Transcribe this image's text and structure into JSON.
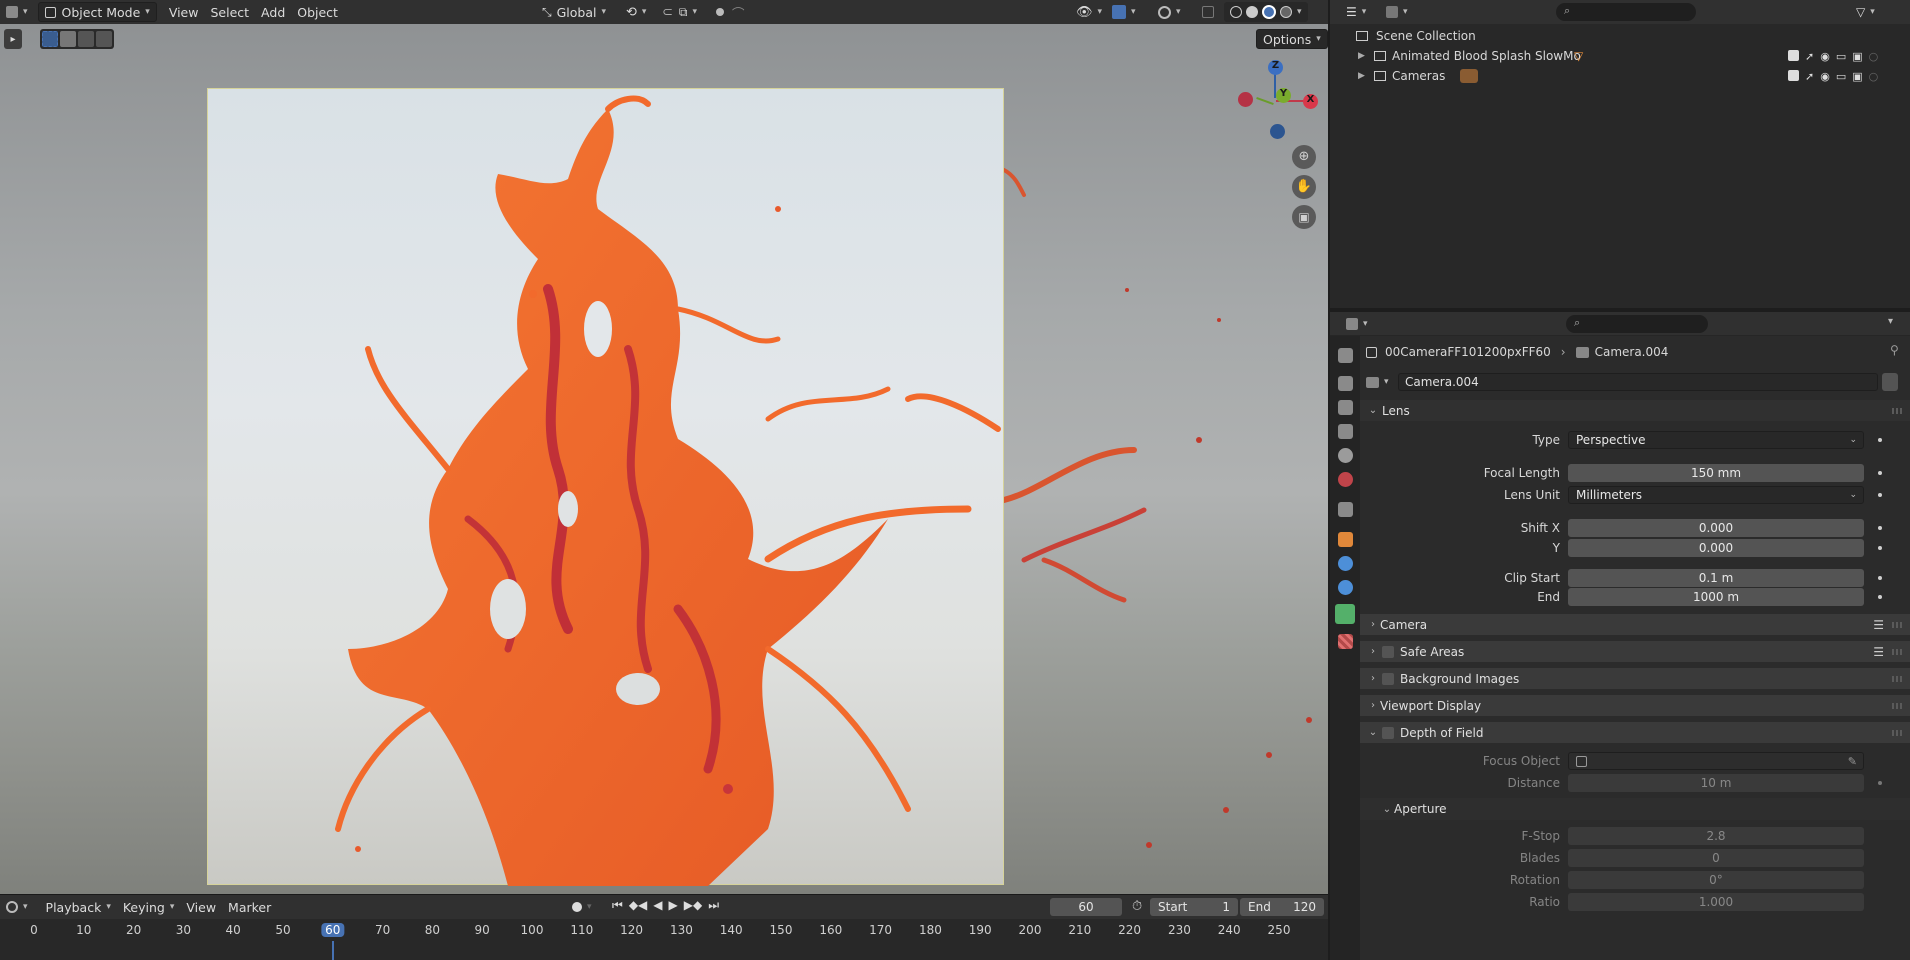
{
  "viewport": {
    "mode": "Object Mode",
    "menu": [
      "View",
      "Select",
      "Add",
      "Object"
    ],
    "transform_orientation": "Global",
    "options_label": "Options",
    "gizmo_axes": {
      "z": "Z",
      "x": "X",
      "y": "Y"
    }
  },
  "timeline": {
    "menu": [
      "Playback",
      "Keying",
      "View",
      "Marker"
    ],
    "current_frame": "60",
    "start_label": "Start",
    "start_value": "1",
    "end_label": "End",
    "end_value": "120",
    "ticks": [
      "0",
      "10",
      "20",
      "30",
      "40",
      "50",
      "60",
      "70",
      "80",
      "90",
      "100",
      "110",
      "120",
      "130",
      "140",
      "150",
      "160",
      "170",
      "180",
      "190",
      "200",
      "210",
      "220",
      "230",
      "240",
      "250"
    ]
  },
  "outliner": {
    "root": "Scene Collection",
    "items": [
      {
        "label": "Animated Blood Splash SlowMo"
      },
      {
        "label": "Cameras"
      }
    ]
  },
  "properties": {
    "breadcrumb_object": "00CameraFF101200pxFF60",
    "breadcrumb_data": "Camera.004",
    "datablock_name": "Camera.004",
    "lens": {
      "title": "Lens",
      "type_label": "Type",
      "type_value": "Perspective",
      "focal_label": "Focal Length",
      "focal_value": "150 mm",
      "unit_label": "Lens Unit",
      "unit_value": "Millimeters",
      "shiftx_label": "Shift X",
      "shiftx_value": "0.000",
      "shifty_label": "Y",
      "shifty_value": "0.000",
      "clipstart_label": "Clip Start",
      "clipstart_value": "0.1 m",
      "clipend_label": "End",
      "clipend_value": "1000 m"
    },
    "panels": {
      "camera": "Camera",
      "safe_areas": "Safe Areas",
      "background_images": "Background Images",
      "viewport_display": "Viewport Display",
      "dof": "Depth of Field"
    },
    "dof": {
      "focus_object_label": "Focus Object",
      "distance_label": "Distance",
      "distance_value": "10 m",
      "aperture_title": "Aperture",
      "fstop_label": "F-Stop",
      "fstop_value": "2.8",
      "blades_label": "Blades",
      "blades_value": "0",
      "rotation_label": "Rotation",
      "rotation_value": "0°",
      "ratio_label": "Ratio",
      "ratio_value": "1.000"
    }
  },
  "colors": {
    "accent": "#4772b3",
    "splash_main": "#f26a2c",
    "splash_dark": "#b8263a",
    "camera_frame": "#d6d39a"
  }
}
